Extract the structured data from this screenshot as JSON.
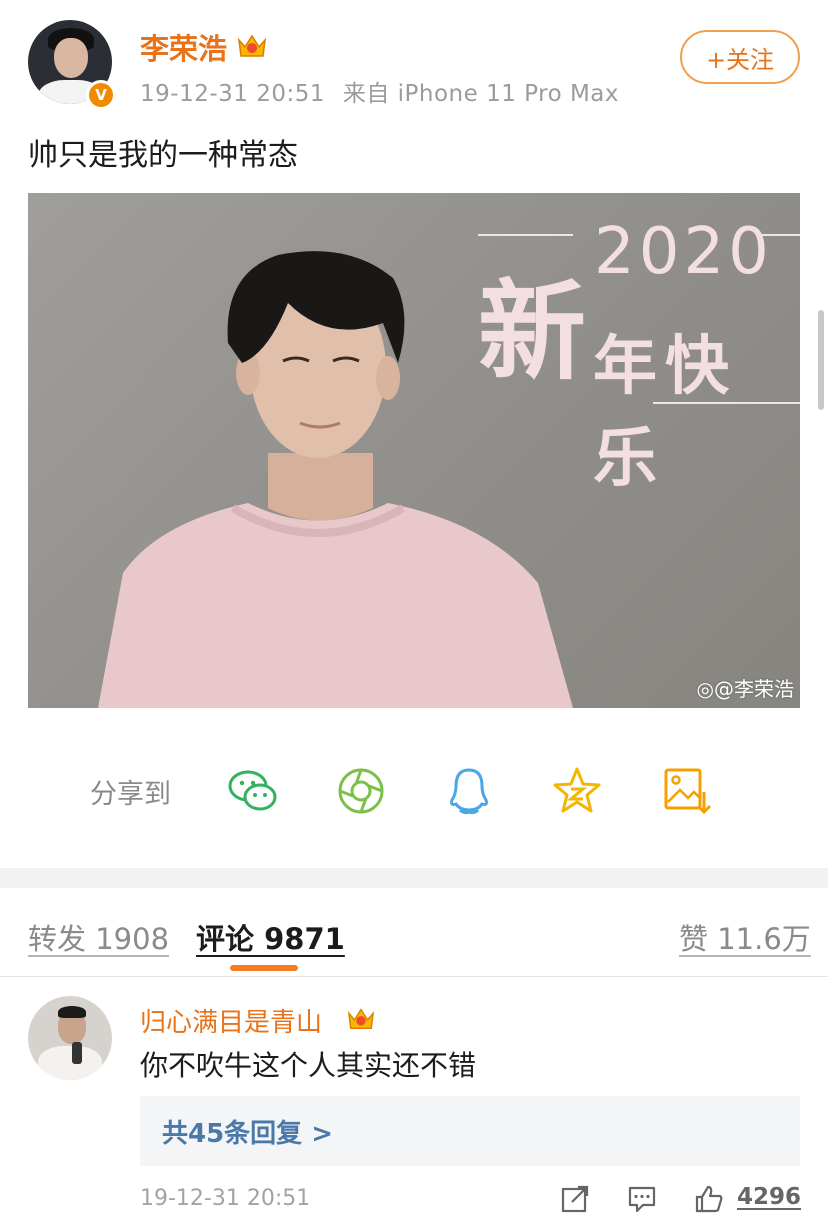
{
  "post": {
    "username": "李荣浩",
    "timestamp": "19-12-31 20:51",
    "source": "来自 iPhone 11 Pro Max",
    "follow_label": "+关注",
    "text": "帅只是我的一种常态",
    "image": {
      "year": "2020",
      "big_char": "新",
      "greeting": "年快乐",
      "watermark": "@李荣浩"
    },
    "verified_badge": "V"
  },
  "share": {
    "label": "分享到",
    "icons": [
      "wechat-icon",
      "moments-icon",
      "qq-icon",
      "qzone-icon",
      "save-image-icon"
    ],
    "colors": {
      "wechat": "#32b25e",
      "moments": "#7cc04a",
      "qq": "#4aa7e6",
      "qzone": "#f2b600",
      "save": "#f2a100"
    }
  },
  "tabs": {
    "repost": "转发 1908",
    "comment": "评论 9871",
    "likes": "赞 11.6万"
  },
  "comment": {
    "username": "归心满目是青山",
    "text": "你不吹牛这个人其实还不错",
    "replies_label": "共45条回复 >",
    "timestamp": "19-12-31 20:51",
    "like_count": "4296"
  },
  "colors": {
    "accent": "#e8731a",
    "tab_indicator": "#f57c1f",
    "link": "#4a78a8"
  }
}
